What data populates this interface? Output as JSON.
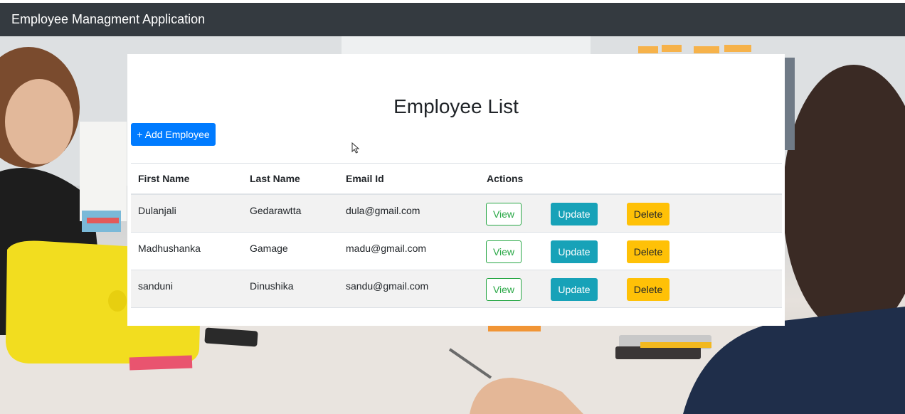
{
  "navbar": {
    "brand": "Employee Managment Application"
  },
  "page": {
    "title": "Employee List",
    "add_button": "+ Add Employee"
  },
  "table": {
    "headers": [
      "First Name",
      "Last Name",
      "Email Id",
      "Actions"
    ],
    "rows": [
      {
        "first": "Dulanjali",
        "last": "Gedarawtta",
        "email": "dula@gmail.com"
      },
      {
        "first": "Madhushanka",
        "last": "Gamage",
        "email": "madu@gmail.com"
      },
      {
        "first": "sanduni",
        "last": "Dinushika",
        "email": "sandu@gmail.com"
      }
    ],
    "actions": {
      "view": "View",
      "update": "Update",
      "delete": "Delete"
    }
  },
  "colors": {
    "navbar": "#343a40",
    "primary": "#007bff",
    "success": "#28a745",
    "info": "#17a2b8",
    "warning": "#ffc107"
  },
  "icons": {
    "cursor": "mouse-pointer-icon"
  }
}
